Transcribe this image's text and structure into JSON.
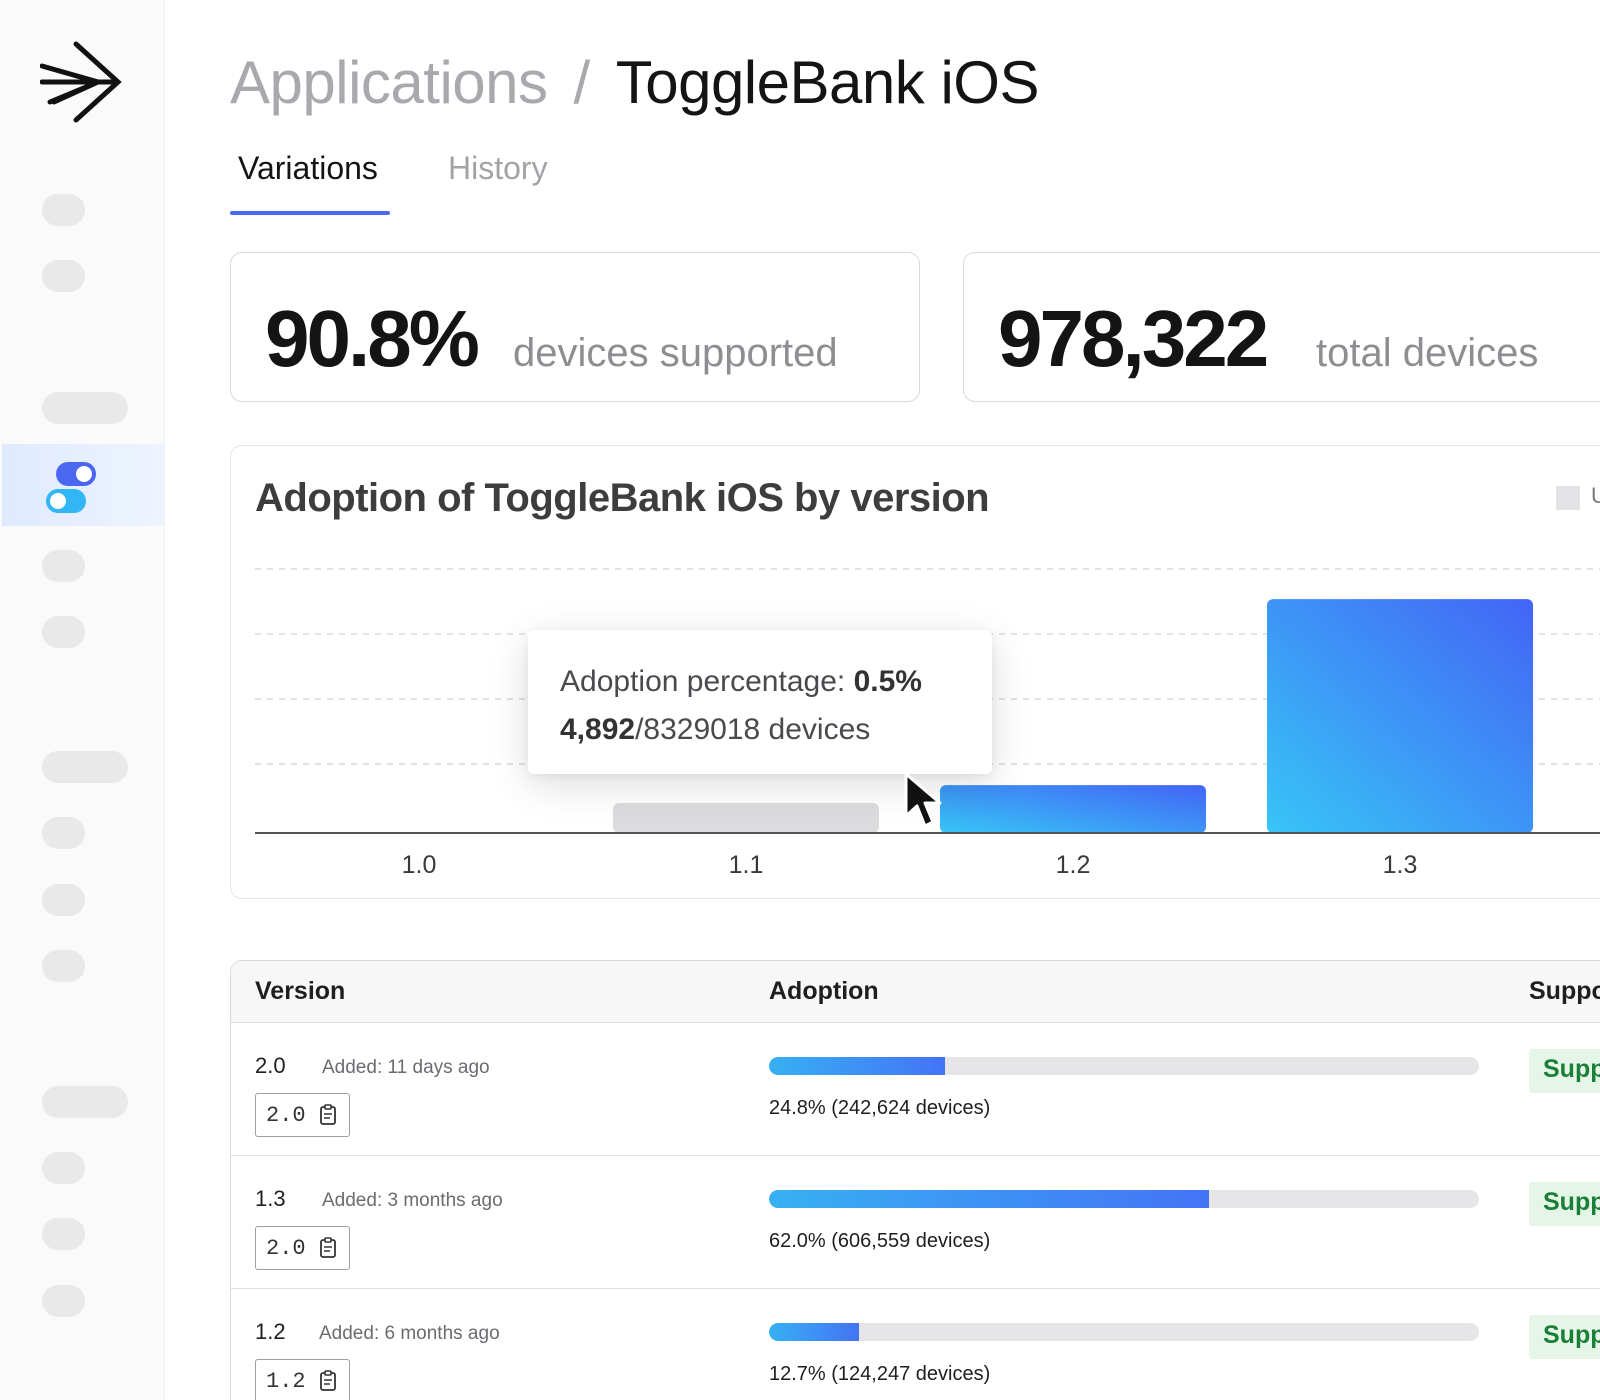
{
  "colors": {
    "accent": "#4d68f0",
    "bar_gradient_start": "#37c5f6",
    "bar_gradient_end": "#4364f6",
    "supported_bg": "#e5f6e9",
    "supported_text": "#1a7f37"
  },
  "sidebar": {
    "logo_icon": "launchdarkly-arrow-logo",
    "active_icon": "toggle-switch-icon"
  },
  "header": {
    "breadcrumb_parent": "Applications",
    "breadcrumb_separator": "/",
    "breadcrumb_current": "ToggleBank iOS"
  },
  "tabs": [
    {
      "label": "Variations",
      "active": true
    },
    {
      "label": "History",
      "active": false
    }
  ],
  "stats": [
    {
      "value": "90.8%",
      "label": "devices supported"
    },
    {
      "value": "978,322",
      "label": "total devices"
    }
  ],
  "chart": {
    "legend_partial": "U"
  },
  "chart_data": {
    "type": "bar",
    "title": "Adoption of ToggleBank iOS by version",
    "categories": [
      "1.0",
      "1.1",
      "1.2",
      "1.3"
    ],
    "values": [
      0,
      0.5,
      12.7,
      62.0
    ],
    "highlighted": [
      false,
      true,
      false,
      false
    ],
    "ylim": [
      0,
      70
    ],
    "grid": true,
    "xlabel": "",
    "ylabel": ""
  },
  "tooltip": {
    "label": "Adoption percentage: ",
    "value": "0.5%",
    "count": "4,892",
    "total_text": "/8329018 devices"
  },
  "table": {
    "headers": [
      "Version",
      "Adoption",
      "Suppo"
    ],
    "rows": [
      {
        "version": "2.0",
        "added": "Added: 11 days ago",
        "chip": "2.0",
        "adoption_fraction": 0.248,
        "adoption_text": "24.8% (242,624 devices)",
        "status": "Supp"
      },
      {
        "version": "1.3",
        "added": "Added: 3 months ago",
        "chip": "2.0",
        "adoption_fraction": 0.62,
        "adoption_text": "62.0% (606,559 devices)",
        "status": "Supp"
      },
      {
        "version": "1.2",
        "added": "Added: 6 months ago",
        "chip": "1.2",
        "adoption_fraction": 0.127,
        "adoption_text": "12.7% (124,247 devices)",
        "status": "Supp"
      }
    ]
  }
}
